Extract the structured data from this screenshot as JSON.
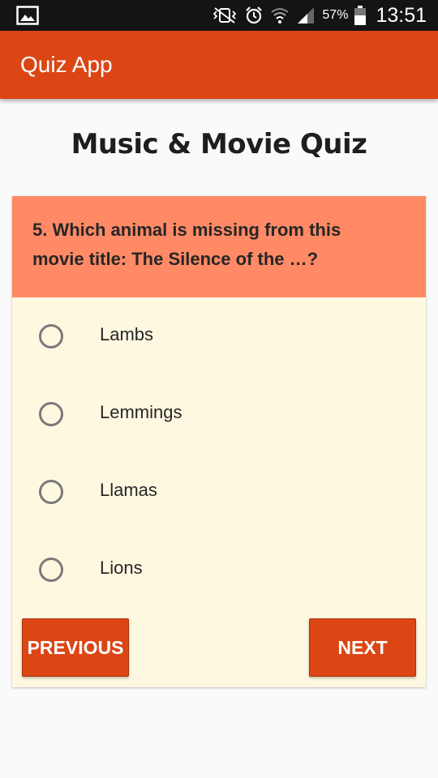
{
  "status_bar": {
    "battery_percent": "57%",
    "time": "13:51",
    "icons": [
      "gallery-icon",
      "mute-vibrate-icon",
      "alarm-icon",
      "wifi-icon",
      "signal-icon",
      "battery-icon"
    ]
  },
  "app_bar": {
    "title": "Quiz App",
    "color": "#db4614"
  },
  "quiz": {
    "title": "Music & Movie Quiz",
    "question": "5. Which animal is missing from this movie title: The Silence of the …?",
    "question_bg": "#ff8a65",
    "card_bg": "#fff8e1",
    "options": [
      {
        "label": "Lambs",
        "selected": false
      },
      {
        "label": "Lemmings",
        "selected": false
      },
      {
        "label": "Llamas",
        "selected": false
      },
      {
        "label": "Lions",
        "selected": false
      }
    ]
  },
  "buttons": {
    "previous": "PREVIOUS",
    "next": "NEXT"
  }
}
